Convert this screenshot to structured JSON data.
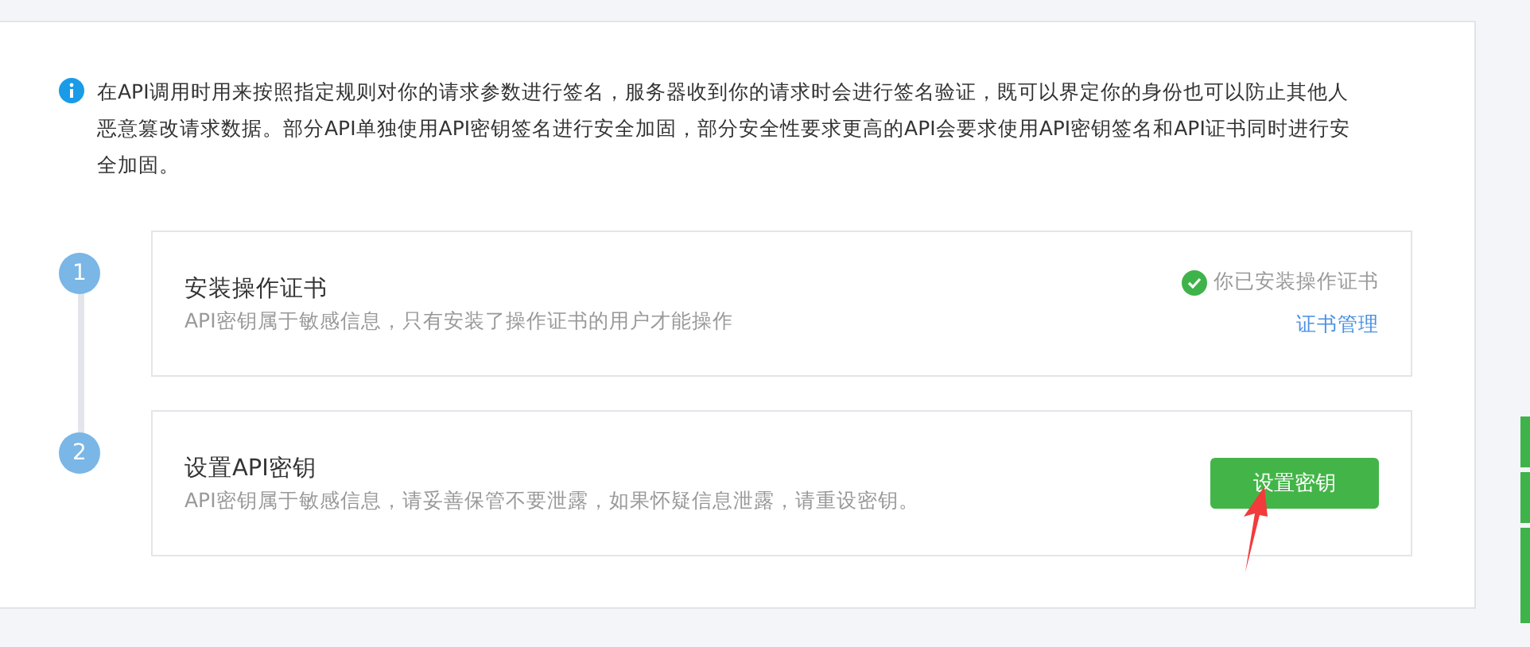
{
  "intro": {
    "text": "在API调用时用来按照指定规则对你的请求参数进行签名，服务器收到你的请求时会进行签名验证，既可以界定你的身份也可以防止其他人恶意篡改请求数据。部分API单独使用API密钥签名进行安全加固，部分安全性要求更高的API会要求使用API密钥签名和API证书同时进行安全加固。"
  },
  "steps": [
    {
      "number": "1",
      "title": "安装操作证书",
      "description": "API密钥属于敏感信息，只有安装了操作证书的用户才能操作",
      "kind": "status",
      "status": "你已安装操作证书",
      "link": "证书管理"
    },
    {
      "number": "2",
      "title": "设置API密钥",
      "description": "API密钥属于敏感信息，请妥善保管不要泄露，如果怀疑信息泄露，请重设密钥。",
      "kind": "button",
      "button": "设置密钥"
    }
  ]
}
